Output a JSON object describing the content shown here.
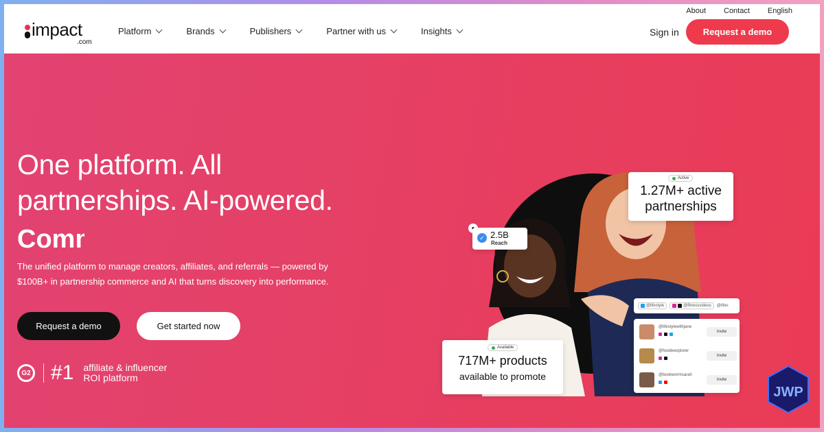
{
  "header": {
    "logo_text": "impact",
    "logo_sub": ".com",
    "top_links": [
      "About",
      "Contact",
      "English"
    ],
    "nav": [
      "Platform",
      "Brands",
      "Publishers",
      "Partner with us",
      "Insights"
    ],
    "sign_in": "Sign in",
    "cta": "Request a demo"
  },
  "hero": {
    "headline_line1": "One platform. All",
    "headline_line2": "partnerships. AI-powered.",
    "headline_rotating": "Comm",
    "subtext_line1": "The unified platform to manage creators, affiliates, and referrals — powered by",
    "subtext_line2": "$100B+ in partnership commerce and AI that turns discovery into performance.",
    "btn_primary": "Request a demo",
    "btn_secondary": "Get started now",
    "g2_logo": "G2",
    "g2_rank": "#1",
    "g2_line1": "affiliate & influencer",
    "g2_line2": "ROI platform"
  },
  "visual": {
    "reach_value": "2.5B",
    "reach_label": "Reach",
    "active_badge": "Active",
    "active_line1": "1.27M+ active",
    "active_line2": "partnerships",
    "products_badge": "Available",
    "products_line1": "717M+ products",
    "products_line2": "available to promote",
    "search_chips": [
      "@lifestyle",
      "@fitnessvideos",
      "@lifes"
    ],
    "creators": [
      {
        "handle": "@lifestylewithjane",
        "action": "Invite"
      },
      {
        "handle": "@foodieexplorer",
        "action": "Invite"
      },
      {
        "handle": "@bookwormsarah",
        "action": "Invite"
      }
    ]
  },
  "watermark": {
    "text": "JWP"
  },
  "colors": {
    "accent": "#ee3a4c",
    "hero_bg": "#e63f63",
    "dark_button": "#111111"
  }
}
